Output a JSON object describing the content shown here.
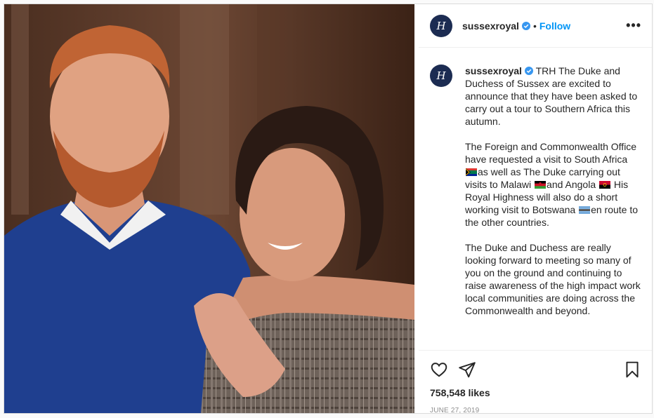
{
  "post": {
    "username": "sussexroyal",
    "avatar_monogram": "H",
    "follow_label": "Follow",
    "separator": "•",
    "more_label": "•••",
    "image_desc_icon": "photo",
    "caption_username": "sussexroyal",
    "caption_p1": "TRH The Duke and Duchess of Sussex are excited to announce that they have been asked to carry out a tour to Southern Africa this autumn.",
    "p2_a": "The Foreign and Commonwealth Office have requested a visit to South Africa ",
    "p2_b": "as well as The Duke carrying out visits to Malawi ",
    "p2_c": "and Angola ",
    "p2_d": " His Royal Highness will also do a short working visit to Botswana ",
    "p2_e": "en route to the other countries.",
    "caption_p3": "The Duke and Duchess are really looking forward to meeting so many of you on the ground and continuing to raise awareness of the high impact work local communities are doing across the Commonwealth and beyond.",
    "likes": "758,548 likes",
    "date": "JUNE 27, 2019"
  },
  "colors": {
    "accent": "#0095f6",
    "verified": "#3897f0",
    "text": "#262626",
    "muted": "#8e8e8e"
  },
  "icons": [
    "verified-badge-icon",
    "heart-icon",
    "share-icon",
    "bookmark-icon",
    "more-icon",
    "south-africa-flag-icon",
    "malawi-flag-icon",
    "angola-flag-icon",
    "botswana-flag-icon"
  ]
}
